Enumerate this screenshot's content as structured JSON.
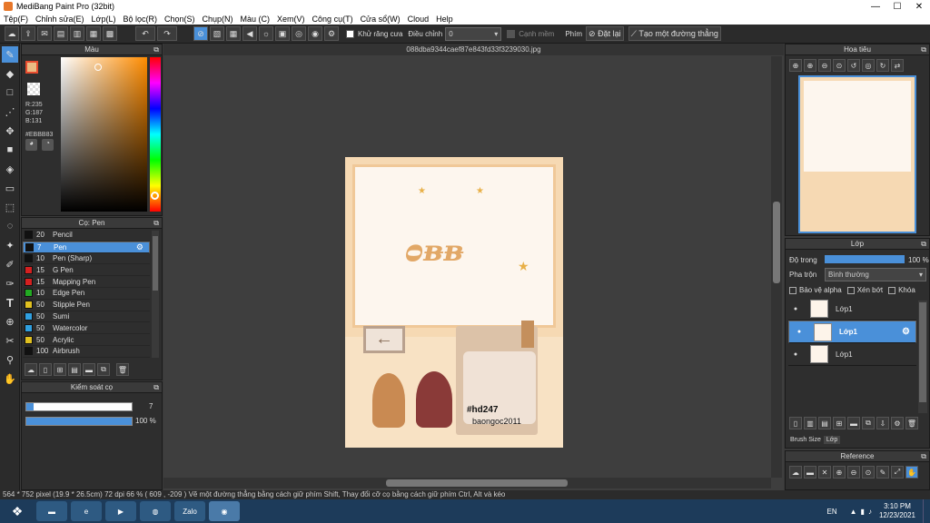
{
  "app": {
    "title": "MediBang Paint Pro (32bit)"
  },
  "window_controls": {
    "minimize": "—",
    "maximize": "☐",
    "close": "✕"
  },
  "menu": [
    "Tệp(F)",
    "Chỉnh sửa(E)",
    "Lớp(L)",
    "Bộ lọc(R)",
    "Chọn(S)",
    "Chụp(N)",
    "Màu (C)",
    "Xem(V)",
    "Công cụ(T)",
    "Cửa sổ(W)",
    "Cloud",
    "Help"
  ],
  "toolbar": {
    "antialias_label": "Khử răng cưa",
    "adjust_label": "Điều chỉnh",
    "adjust_value": "0",
    "smooth_label": "Cạnh mềm",
    "key_label": "Phím",
    "reset_label": "Đặt lại",
    "ruler_label": "Tạo một đường thẳng"
  },
  "document": {
    "tab": "088dba9344caef87e843fd33f3239030.jpg",
    "hashtag": "#hd247",
    "username": "baongoc2011"
  },
  "color_panel": {
    "title": "Màu",
    "r": "R:235",
    "g": "G:187",
    "b": "B:131",
    "hex": "#EBBB83",
    "fg_color": "#EBBB83"
  },
  "brush_panel": {
    "title": "Cọ: Pen",
    "items": [
      {
        "size": "20",
        "name": "Pencil",
        "color": "#111111"
      },
      {
        "size": "7",
        "name": "Pen",
        "color": "#111111",
        "selected": true
      },
      {
        "size": "10",
        "name": "Pen (Sharp)",
        "color": "#111111"
      },
      {
        "size": "15",
        "name": "G Pen",
        "color": "#d42020"
      },
      {
        "size": "15",
        "name": "Mapping Pen",
        "color": "#d42020"
      },
      {
        "size": "10",
        "name": "Edge Pen",
        "color": "#22aa22"
      },
      {
        "size": "50",
        "name": "Stipple Pen",
        "color": "#e0c020"
      },
      {
        "size": "50",
        "name": "Sumi",
        "color": "#30a0e0"
      },
      {
        "size": "50",
        "name": "Watercolor",
        "color": "#30a0e0"
      },
      {
        "size": "50",
        "name": "Acrylic",
        "color": "#e0c020"
      },
      {
        "size": "100",
        "name": "Airbrush",
        "color": "#111111"
      }
    ]
  },
  "brush_control": {
    "title": "Kiểm soát cọ",
    "size": "7",
    "opacity": "100 %",
    "size_fraction": 0.07,
    "opacity_fraction": 1.0
  },
  "navigator": {
    "title": "Hoa tiêu"
  },
  "layer_panel": {
    "title": "Lớp",
    "opacity_label": "Độ trong",
    "opacity_value": "100 %",
    "blend_label": "Pha trộn",
    "blend_value": "Bình thường",
    "protect_alpha": "Bảo vệ alpha",
    "clipping": "Xén bớt",
    "lock": "Khóa",
    "layers": [
      {
        "name": "Lớp1"
      },
      {
        "name": "Lớp1",
        "selected": true
      },
      {
        "name": "Lớp1"
      }
    ]
  },
  "bottom_tabs": {
    "brush_size": "Brush Size",
    "layer": "Lớp"
  },
  "reference": {
    "title": "Reference"
  },
  "status": {
    "text": "564 * 752 pixel   (19.9 * 26.5cm)   72 dpi   66 %   ( 609 , -209 )   Vẽ một đường thẳng bằng cách giữ phím Shift, Thay đổi cỡ cọ bằng cách giữ phím Ctrl, Alt và kéo"
  },
  "taskbar": {
    "zalo": "Zalo",
    "lang": "EN",
    "time": "3:10 PM",
    "date": "12/23/2021"
  }
}
